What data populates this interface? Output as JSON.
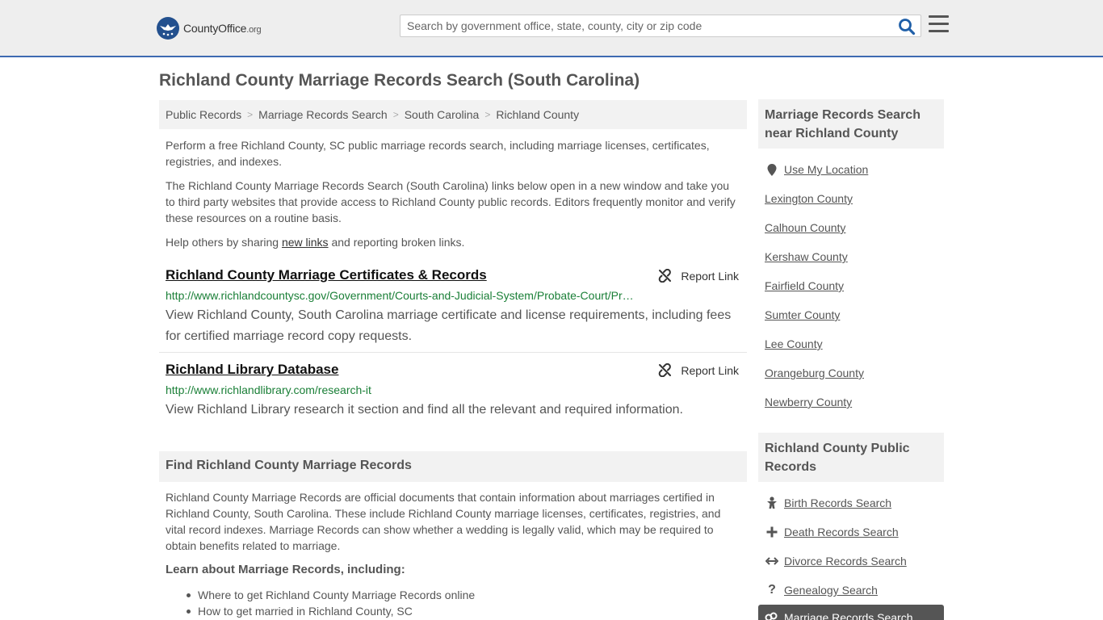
{
  "header": {
    "logo_main": "CountyOffice",
    "logo_suffix": ".org",
    "search_placeholder": "Search by government office, state, county, city or zip code"
  },
  "page_title": "Richland County Marriage Records Search (South Carolina)",
  "breadcrumb": [
    "Public Records",
    "Marriage Records Search",
    "South Carolina",
    "Richland County"
  ],
  "intro": {
    "p1": "Perform a free Richland County, SC public marriage records search, including marriage licenses, certificates, registries, and indexes.",
    "p2": "The Richland County Marriage Records Search (South Carolina) links below open in a new window and take you to third party websites that provide access to Richland County public records. Editors frequently monitor and verify these resources on a routine basis.",
    "p3_before": "Help others by sharing ",
    "p3_link": "new links",
    "p3_after": " and reporting broken links."
  },
  "results": [
    {
      "title": "Richland County Marriage Certificates & Records",
      "url": "http://www.richlandcountysc.gov/Government/Courts-and-Judicial-System/Probate-Court/Pr…",
      "description": "View Richland County, South Carolina marriage certificate and license requirements, including fees for certified marriage record copy requests.",
      "report_label": "Report Link"
    },
    {
      "title": "Richland Library Database",
      "url": "http://www.richlandlibrary.com/research-it",
      "description": "View Richland Library research it section and find all the relevant and required information.",
      "report_label": "Report Link"
    }
  ],
  "find_section": {
    "heading": "Find Richland County Marriage Records",
    "text": "Richland County Marriage Records are official documents that contain information about marriages certified in Richland County, South Carolina. These include Richland County marriage licenses, certificates, registries, and vital record indexes. Marriage Records can show whether a wedding is legally valid, which may be required to obtain benefits related to marriage.",
    "learn_heading": "Learn about Marriage Records, including:",
    "learn_items": [
      "Where to get Richland County Marriage Records online",
      "How to get married in Richland County, SC"
    ]
  },
  "sidebar": {
    "nearby_heading": "Marriage Records Search near Richland County",
    "nearby_items": [
      "Use My Location",
      "Lexington County",
      "Calhoun County",
      "Kershaw County",
      "Fairfield County",
      "Sumter County",
      "Lee County",
      "Orangeburg County",
      "Newberry County"
    ],
    "public_heading": "Richland County Public Records",
    "public_items": [
      {
        "label": "Birth Records Search",
        "icon": "baby-icon"
      },
      {
        "label": "Death Records Search",
        "icon": "cross-icon"
      },
      {
        "label": "Divorce Records Search",
        "icon": "split-arrows-icon"
      },
      {
        "label": "Genealogy Search",
        "icon": "question-icon"
      }
    ],
    "active_item": {
      "label": "Marriage Records Search",
      "icon": "gender-rings-icon"
    }
  },
  "colors": {
    "header_bg": "#eeeeee",
    "header_border": "#3d6ab1",
    "logo_blue": "#23508e",
    "search_icon": "#1f5fa8",
    "url_green": "#1a7f37"
  }
}
